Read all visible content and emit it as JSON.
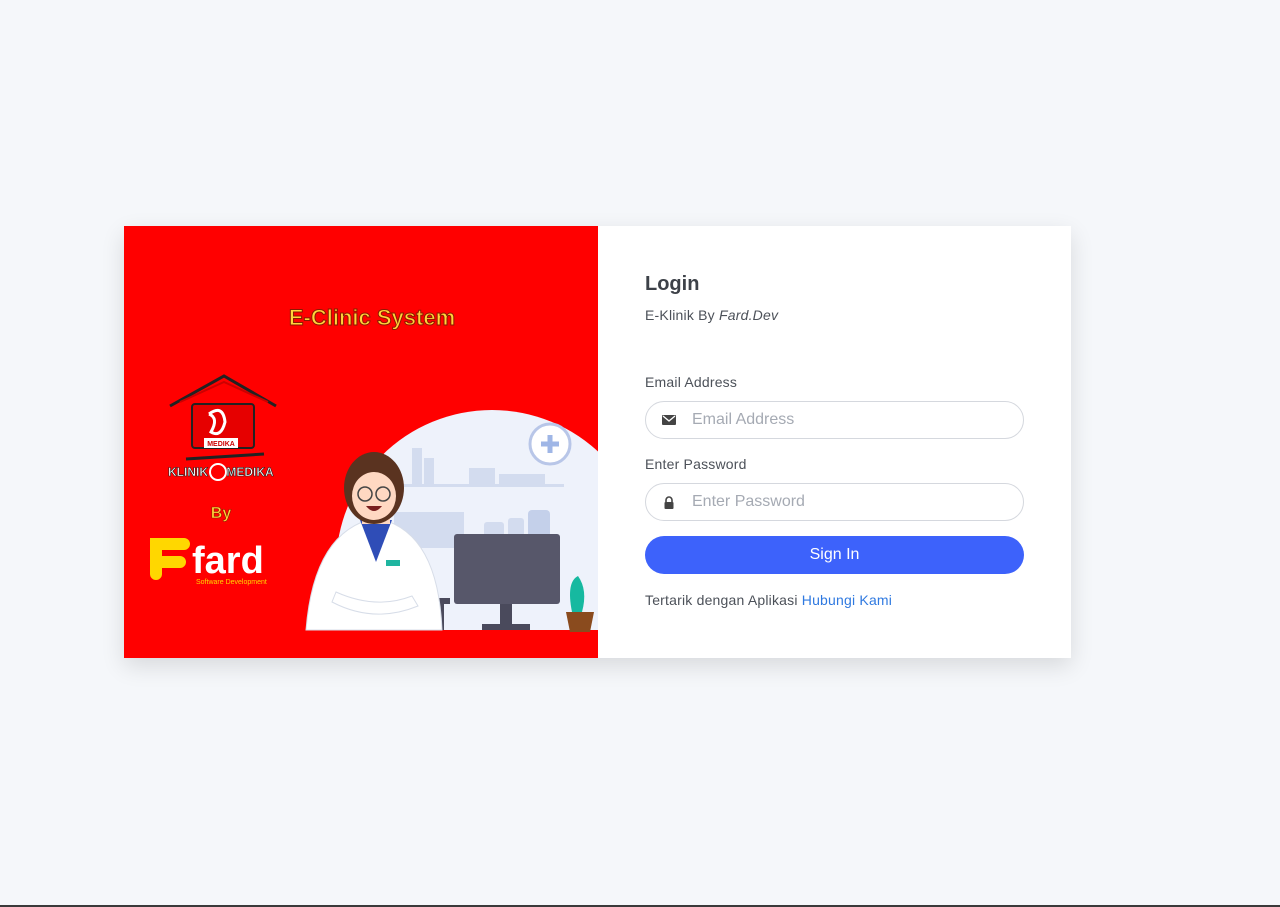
{
  "banner": {
    "heading": "E-Clinic System",
    "clinic_name_left": "KLINIK",
    "clinic_name_right": "MEDIKA",
    "clinic_badge": "MEDIKA",
    "by_label": "By",
    "brand_name": "fard",
    "brand_tagline": "Software Development",
    "colors": {
      "background": "#ff0000",
      "heading": "#ffd43b",
      "brand_yellow": "#ffd700"
    }
  },
  "login": {
    "title": "Login",
    "subtitle_prefix": "E-Klinik By",
    "subtitle_brand": "Fard.Dev",
    "email": {
      "label": "Email Address",
      "placeholder": "Email Address",
      "icon": "envelope-icon"
    },
    "password": {
      "label": "Enter Password",
      "placeholder": "Enter Password",
      "icon": "lock-icon"
    },
    "submit_label": "Sign In",
    "footer_text": "Tertarik dengan Aplikasi",
    "footer_link": "Hubungi Kami",
    "colors": {
      "primary": "#3d62fb",
      "link": "#2f79e0"
    }
  }
}
